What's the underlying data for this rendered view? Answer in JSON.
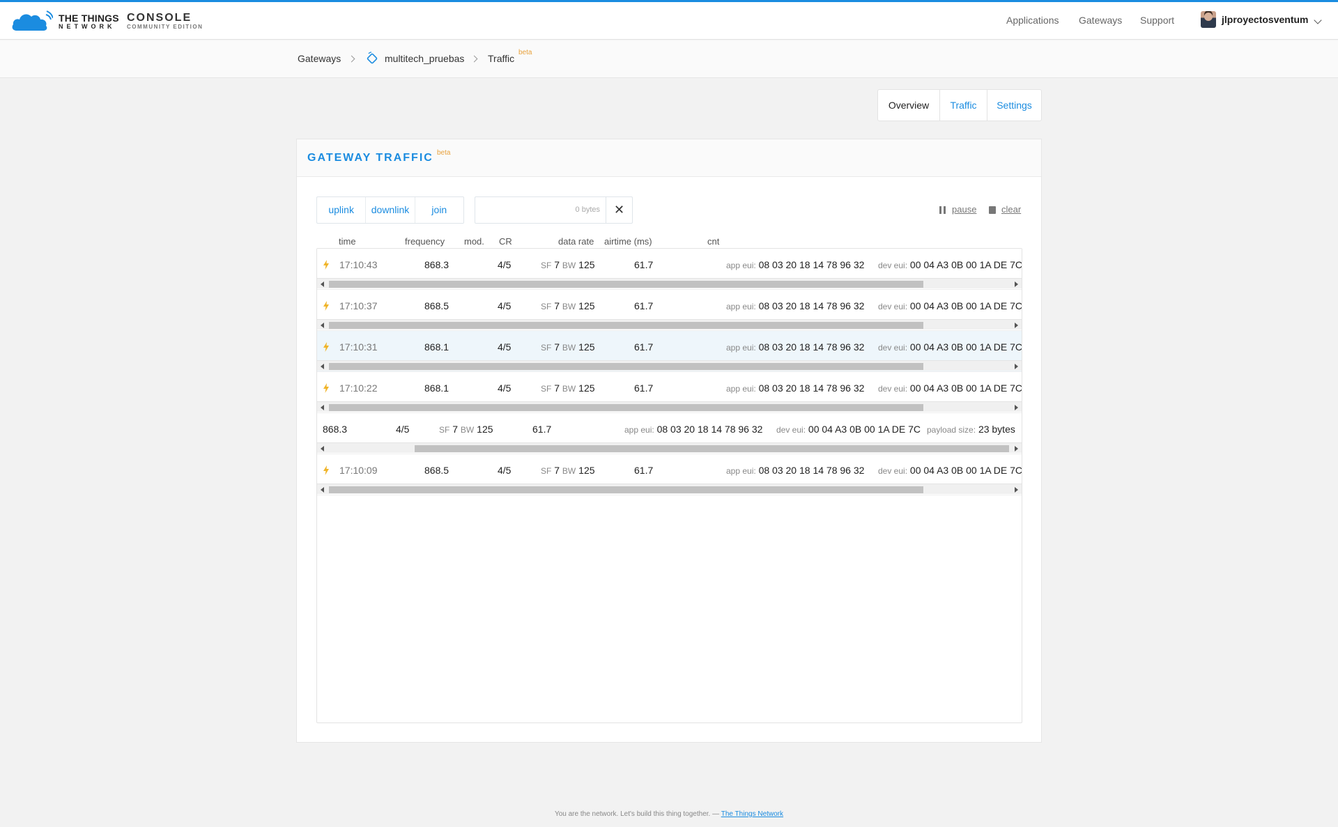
{
  "header": {
    "brand_line1": "THE THINGS",
    "brand_line2": "NETWORK",
    "console": "CONSOLE",
    "edition": "COMMUNITY EDITION",
    "nav": {
      "applications": "Applications",
      "gateways": "Gateways",
      "support": "Support"
    },
    "username": "jlproyectosventum"
  },
  "breadcrumb": {
    "gateways": "Gateways",
    "device": "multitech_pruebas",
    "traffic": "Traffic",
    "beta": "beta"
  },
  "tabs": {
    "overview": "Overview",
    "traffic": "Traffic",
    "settings": "Settings"
  },
  "card": {
    "title": "GATEWAY TRAFFIC",
    "beta": "beta"
  },
  "filters": {
    "uplink": "uplink",
    "downlink": "downlink",
    "join": "join",
    "bytes_placeholder": "0 bytes",
    "clear_x": "✕",
    "pause": "pause",
    "clear": "clear"
  },
  "columns": {
    "time": "time",
    "frequency": "frequency",
    "mod": "mod.",
    "cr": "CR",
    "data_rate": "data rate",
    "airtime": "airtime (ms)",
    "cnt": "cnt"
  },
  "labels": {
    "sf": "SF",
    "bw": "BW",
    "app_eui": "app eui:",
    "dev_eui": "dev eui:",
    "payload_size": "payload size:"
  },
  "rows": [
    {
      "time": "17:10:43",
      "freq": "868.3",
      "cr": "4/5",
      "sf": "7",
      "bw": "125",
      "airtime": "61.7",
      "app_eui": "08 03 20 18 14 78 96 32",
      "dev_eui": "00 04 A3 0B 00 1A DE 7C"
    },
    {
      "time": "17:10:37",
      "freq": "868.5",
      "cr": "4/5",
      "sf": "7",
      "bw": "125",
      "airtime": "61.7",
      "app_eui": "08 03 20 18 14 78 96 32",
      "dev_eui": "00 04 A3 0B 00 1A DE 7C"
    },
    {
      "time": "17:10:31",
      "freq": "868.1",
      "cr": "4/5",
      "sf": "7",
      "bw": "125",
      "airtime": "61.7",
      "app_eui": "08 03 20 18 14 78 96 32",
      "dev_eui": "00 04 A3 0B 00 1A DE 7C"
    },
    {
      "time": "17:10:22",
      "freq": "868.1",
      "cr": "4/5",
      "sf": "7",
      "bw": "125",
      "airtime": "61.7",
      "app_eui": "08 03 20 18 14 78 96 32",
      "dev_eui": "00 04 A3 0B 00 1A DE 7C"
    },
    {
      "time": "",
      "freq": "868.3",
      "cr": "4/5",
      "sf": "7",
      "bw": "125",
      "airtime": "61.7",
      "app_eui": "08 03 20 18 14 78 96 32",
      "dev_eui": "00 04 A3 0B 00 1A DE 7C",
      "payload_size": "23 bytes"
    },
    {
      "time": "17:10:09",
      "freq": "868.5",
      "cr": "4/5",
      "sf": "7",
      "bw": "125",
      "airtime": "61.7",
      "app_eui": "08 03 20 18 14 78 96 32",
      "dev_eui": "00 04 A3 0B 00 1A DE 7C"
    }
  ],
  "footer": {
    "text": "You are the network. Let's build this thing together. —",
    "link": "The Things Network"
  },
  "colors": {
    "accent": "#1b8ce0",
    "beta": "#e8a23d",
    "bolt": "#f0b429"
  }
}
